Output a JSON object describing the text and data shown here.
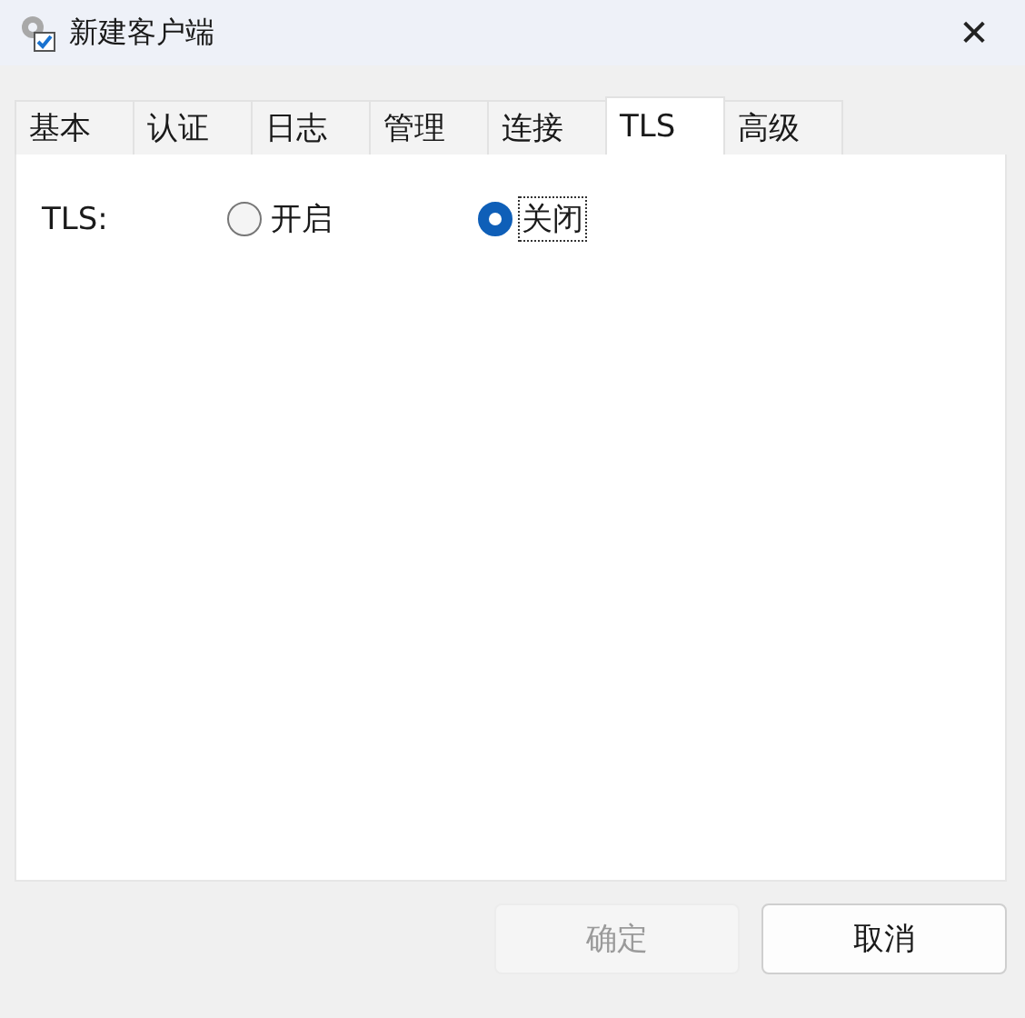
{
  "window": {
    "title": "新建客户端",
    "close": "✕"
  },
  "tabs": [
    {
      "label": "基本",
      "selected": false
    },
    {
      "label": "认证",
      "selected": false
    },
    {
      "label": "日志",
      "selected": false
    },
    {
      "label": "管理",
      "selected": false
    },
    {
      "label": "连接",
      "selected": false
    },
    {
      "label": "TLS",
      "selected": true
    },
    {
      "label": "高级",
      "selected": false
    }
  ],
  "tls": {
    "label": "TLS:",
    "options": [
      {
        "label": "开启",
        "selected": false,
        "focused": false
      },
      {
        "label": "关闭",
        "selected": true,
        "focused": true
      }
    ]
  },
  "buttons": [
    {
      "label": "确定",
      "disabled": true
    },
    {
      "label": "取消",
      "disabled": false
    }
  ]
}
